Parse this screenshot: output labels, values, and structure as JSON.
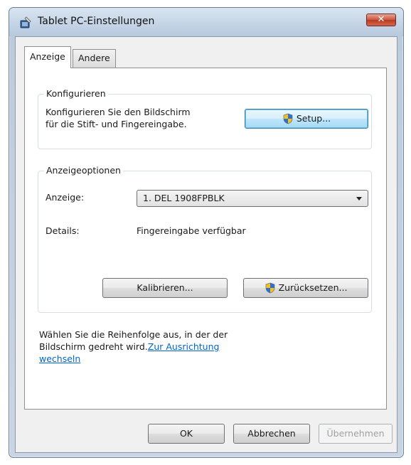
{
  "window": {
    "title": "Tablet PC-Einstellungen",
    "close_label": "✕"
  },
  "tabs": [
    {
      "label": "Anzeige",
      "active": true
    },
    {
      "label": "Andere",
      "active": false
    }
  ],
  "configure": {
    "group_title": "Konfigurieren",
    "description_line1": "Konfigurieren Sie den Bildschirm",
    "description_line2": "für die Stift- und Fingereingabe.",
    "setup_label": "Setup..."
  },
  "display_options": {
    "group_title": "Anzeigeoptionen",
    "display_label": "Anzeige:",
    "display_value": "1. DEL 1908FPBLK",
    "details_label": "Details:",
    "details_value": "Fingereingabe verfügbar",
    "calibrate_label": "Kalibrieren...",
    "reset_label": "Zurücksetzen..."
  },
  "orientation": {
    "text_line1": "Wählen Sie die Reihenfolge aus, in der der",
    "text_line2_prefix": "Bildschirm gedreht wird.",
    "link_part1": "Zur Ausrichtung",
    "link_part2": "wechseln"
  },
  "footer": {
    "ok_label": "OK",
    "cancel_label": "Abbrechen",
    "apply_label": "Übernehmen"
  },
  "colors": {
    "link": "#0066cc",
    "close_button": "#c8553e",
    "focus_border": "#3c7fb1"
  },
  "icons": {
    "title": "tablet-pen-icon",
    "button": "uac-shield-icon"
  }
}
